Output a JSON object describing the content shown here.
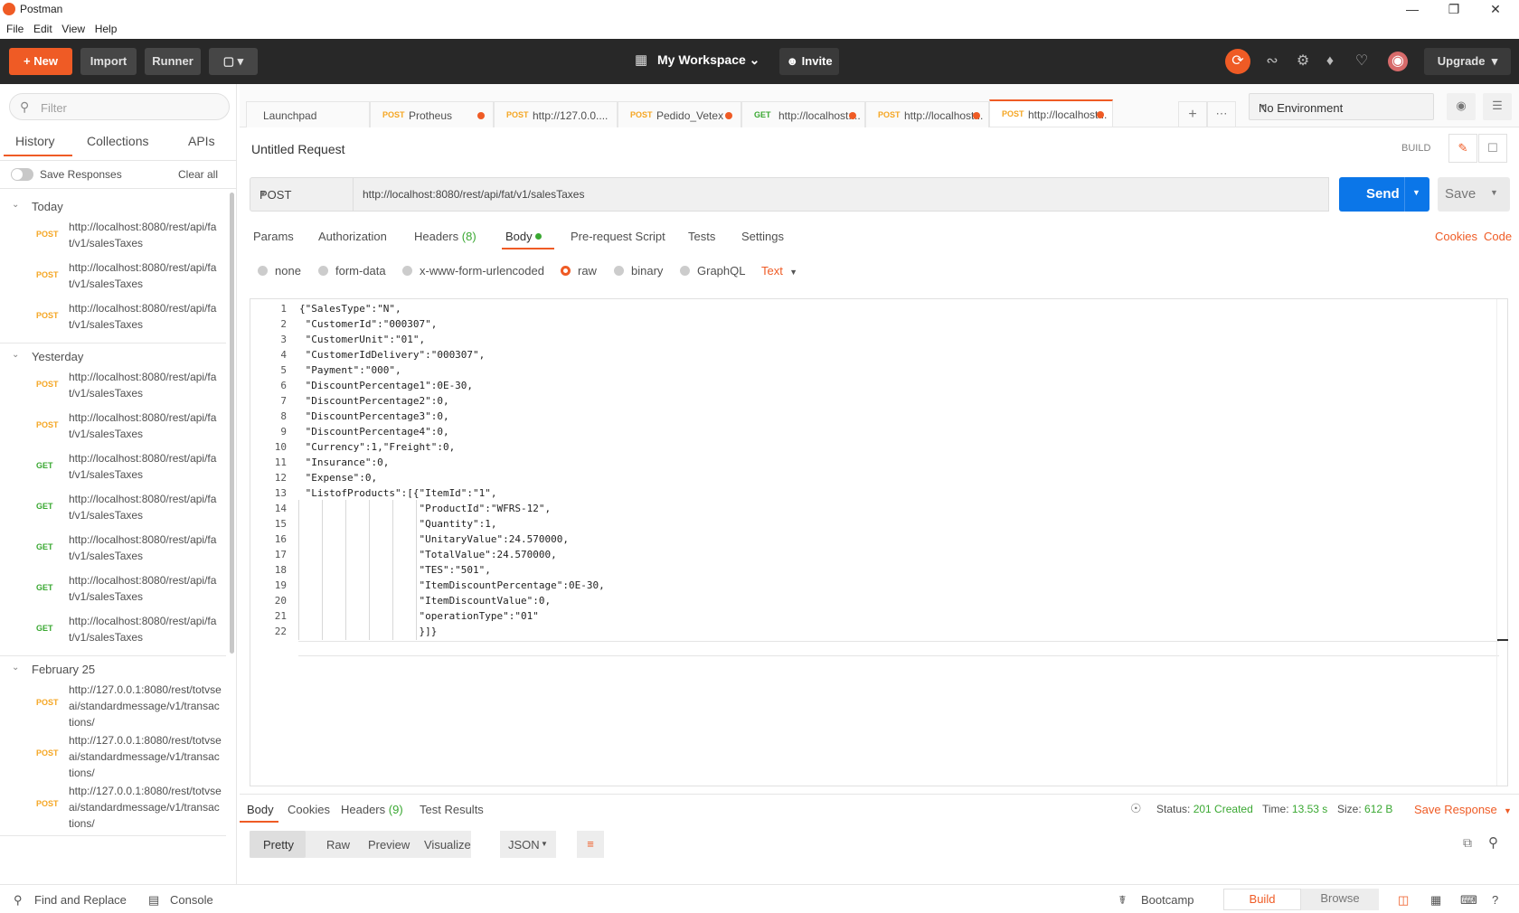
{
  "window": {
    "title": "Postman",
    "menu": [
      "File",
      "Edit",
      "View",
      "Help"
    ]
  },
  "header": {
    "new_label": "New",
    "import_label": "Import",
    "runner_label": "Runner",
    "workspace": "My Workspace",
    "invite": "Invite",
    "upgrade": "Upgrade",
    "accent": "#ef5b25"
  },
  "sidebar": {
    "filter_placeholder": "Filter",
    "tabs": [
      "History",
      "Collections",
      "APIs"
    ],
    "save_responses": "Save Responses",
    "clear_all": "Clear all",
    "groups": [
      {
        "label": "Today",
        "items": [
          {
            "method": "POST",
            "url": "http://localhost:8080/rest/api/fat/v1/salesTaxes"
          },
          {
            "method": "POST",
            "url": "http://localhost:8080/rest/api/fat/v1/salesTaxes"
          },
          {
            "method": "POST",
            "url": "http://localhost:8080/rest/api/fat/v1/salesTaxes"
          }
        ]
      },
      {
        "label": "Yesterday",
        "items": [
          {
            "method": "POST",
            "url": "http://localhost:8080/rest/api/fat/v1/salesTaxes"
          },
          {
            "method": "POST",
            "url": "http://localhost:8080/rest/api/fat/v1/salesTaxes"
          },
          {
            "method": "GET",
            "url": "http://localhost:8080/rest/api/fat/v1/salesTaxes"
          },
          {
            "method": "GET",
            "url": "http://localhost:8080/rest/api/fat/v1/salesTaxes"
          },
          {
            "method": "GET",
            "url": "http://localhost:8080/rest/api/fat/v1/salesTaxes"
          },
          {
            "method": "GET",
            "url": "http://localhost:8080/rest/api/fat/v1/salesTaxes"
          },
          {
            "method": "GET",
            "url": "http://localhost:8080/rest/api/fat/v1/salesTaxes"
          }
        ]
      },
      {
        "label": "February 25",
        "items": [
          {
            "method": "POST",
            "url": "http://127.0.0.1:8080/rest/totvseai/standardmessage/v1/transactions/"
          },
          {
            "method": "POST",
            "url": "http://127.0.0.1:8080/rest/totvseai/standardmessage/v1/transactions/"
          },
          {
            "method": "POST",
            "url": "http://127.0.0.1:8080/rest/totvseai/standardmessage/v1/transactions/"
          }
        ]
      }
    ]
  },
  "tabs": [
    {
      "method": "",
      "label": "Launchpad",
      "dot": false
    },
    {
      "method": "POST",
      "label": "Protheus",
      "dot": true
    },
    {
      "method": "POST",
      "label": "http://127.0.0....",
      "dot": false
    },
    {
      "method": "POST",
      "label": "Pedido_Vetex",
      "dot": true
    },
    {
      "method": "GET",
      "label": "http://localhost:...",
      "dot": true
    },
    {
      "method": "POST",
      "label": "http://localhost...",
      "dot": true
    },
    {
      "method": "POST",
      "label": "http://localhost...",
      "dot": true
    }
  ],
  "environment": "No Environment",
  "request": {
    "name": "Untitled Request",
    "build": "BUILD",
    "method": "POST",
    "url": "http://localhost:8080/rest/api/fat/v1/salesTaxes",
    "send": "Send",
    "save": "Save",
    "subtabs": [
      "Params",
      "Authorization",
      "Headers",
      "Body",
      "Pre-request Script",
      "Tests",
      "Settings"
    ],
    "headers_count": "(8)",
    "cookies": "Cookies",
    "code": "Code",
    "body_modes": [
      "none",
      "form-data",
      "x-www-form-urlencoded",
      "raw",
      "binary",
      "GraphQL"
    ],
    "body_type": "Text",
    "body_lines": [
      "{\"SalesType\":\"N\",",
      " \"CustomerId\":\"000307\",",
      " \"CustomerUnit\":\"01\",",
      " \"CustomerIdDelivery\":\"000307\",",
      " \"Payment\":\"000\",",
      " \"DiscountPercentage1\":0E-30,",
      " \"DiscountPercentage2\":0,",
      " \"DiscountPercentage3\":0,",
      " \"DiscountPercentage4\":0,",
      " \"Currency\":1,\"Freight\":0,",
      " \"Insurance\":0,",
      " \"Expense\":0,",
      " \"ListofProducts\":[{\"ItemId\":\"1\",",
      "                    \"ProductId\":\"WFRS-12\",",
      "                    \"Quantity\":1,",
      "                    \"UnitaryValue\":24.570000,",
      "                    \"TotalValue\":24.570000,",
      "                    \"TES\":\"501\",",
      "                    \"ItemDiscountPercentage\":0E-30,",
      "                    \"ItemDiscountValue\":0,",
      "                    \"operationType\":\"01\"",
      "                    }]}"
    ]
  },
  "response": {
    "tabs": [
      "Body",
      "Cookies",
      "Headers",
      "Test Results"
    ],
    "headers_count": "(9)",
    "status_label": "Status:",
    "status": "201 Created",
    "time_label": "Time:",
    "time": "13.53 s",
    "size_label": "Size:",
    "size": "612 B",
    "save_response": "Save Response",
    "formats": [
      "Pretty",
      "Raw",
      "Preview",
      "Visualize"
    ],
    "lang": "JSON"
  },
  "footer": {
    "find_replace": "Find and Replace",
    "console": "Console",
    "bootcamp": "Bootcamp",
    "build": "Build",
    "browse": "Browse"
  }
}
